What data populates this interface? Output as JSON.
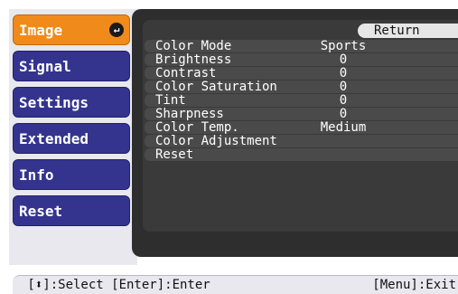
{
  "tabs": [
    {
      "label": "Image",
      "active": true
    },
    {
      "label": "Signal",
      "active": false
    },
    {
      "label": "Settings",
      "active": false
    },
    {
      "label": "Extended",
      "active": false
    },
    {
      "label": "Info",
      "active": false
    },
    {
      "label": "Reset",
      "active": false
    }
  ],
  "enter_icon": "enter-return-icon",
  "return_label": "Return",
  "menu": [
    {
      "label": "Color Mode",
      "value": "Sports"
    },
    {
      "label": "Brightness",
      "value": "0"
    },
    {
      "label": "Contrast",
      "value": "0"
    },
    {
      "label": "Color Saturation",
      "value": "0"
    },
    {
      "label": "Tint",
      "value": "0"
    },
    {
      "label": "Sharpness",
      "value": "0"
    },
    {
      "label": "Color Temp.",
      "value": "Medium"
    },
    {
      "label": "Color Adjustment",
      "value": ""
    },
    {
      "label": "Reset",
      "value": ""
    }
  ],
  "status": {
    "left": " [⬍]:Select [Enter]:Enter",
    "right": "[Menu]:Exit"
  },
  "colors": {
    "active_tab": "#f08a1a",
    "inactive_tab": "#34348f",
    "panel": "#2e2e2e"
  }
}
